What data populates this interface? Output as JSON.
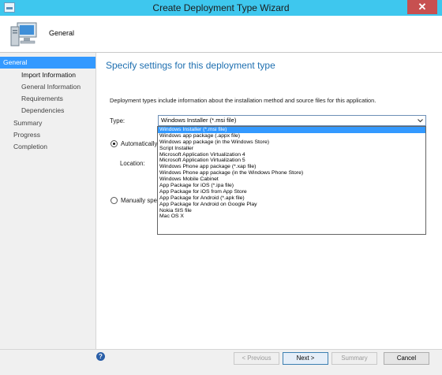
{
  "window": {
    "title": "Create Deployment Type Wizard",
    "close_glyph": "✕"
  },
  "header": {
    "title": "General"
  },
  "nav": {
    "items": [
      {
        "label": "General",
        "active": true
      },
      {
        "label": "Import Information",
        "active": false
      },
      {
        "label": "General Information",
        "active": false
      },
      {
        "label": "Requirements",
        "active": false
      },
      {
        "label": "Dependencies",
        "active": false
      },
      {
        "label": "Summary",
        "active": false
      },
      {
        "label": "Progress",
        "active": false
      },
      {
        "label": "Completion",
        "active": false
      }
    ]
  },
  "main": {
    "heading": "Specify settings for this deployment type",
    "description": "Deployment types include information about the installation method and source files for this application.",
    "type_label": "Type:",
    "type_selected": "Windows Installer (*.msi file)",
    "radio_auto_label": "Automatically i",
    "location_label": "Location:",
    "radio_manual_label": "Manually spec",
    "dropdown_options": [
      "Windows Installer (*.msi file)",
      "Windows app package (.appx file)",
      "Windows app package (in the Windows Store)",
      "Script Installer",
      "Microsoft Application Virtualization 4",
      "Microsoft Application Virtualization 5",
      "Windows Phone app package (*.xap file)",
      "Windows Phone app package (in the Windows Phone Store)",
      "Windows Mobile Cabinet",
      "App Package for iOS (*.ipa file)",
      "App Package for iOS from App Store",
      "App Package for Android (*.apk file)",
      "App Package for Android on Google Play",
      "Nokia SIS file",
      "Mac OS X"
    ]
  },
  "footer": {
    "help_glyph": "?",
    "previous_label": "< Previous",
    "next_label": "Next >",
    "summary_label": "Summary",
    "cancel_label": "Cancel"
  }
}
